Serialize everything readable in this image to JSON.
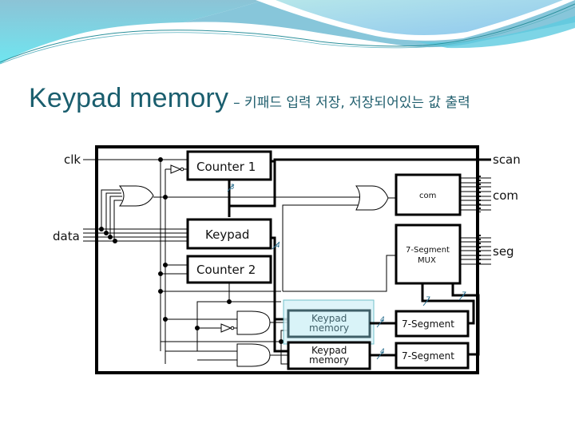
{
  "slide": {
    "title_main": "Keypad memory",
    "title_sub": "– 키패드 입력 저장, 저장되어있는 값 출력",
    "theme_colors": {
      "wave_light": "#a9dde6",
      "wave_mid": "#7fc4d6",
      "wave_cyan": "#6fe0ee",
      "wave_line": "#2a8f9a",
      "title": "#1a5e6e",
      "highlight_fill": "#d9f3f8",
      "highlight_border": "#5bb7c2"
    }
  },
  "diagram": {
    "ports": {
      "clk": "clk",
      "data": "data",
      "scan": "scan",
      "com": "com",
      "seg": "seg"
    },
    "blocks": {
      "counter1": "Counter 1",
      "keypad": "Keypad",
      "counter2": "Counter 2",
      "com": "com",
      "mux_line1": "7-Segment",
      "mux_line2": "MUX",
      "mem1_line1": "Keypad",
      "mem1_line2": "memory",
      "mem2_line1": "Keypad",
      "mem2_line2": "memory",
      "seg1": "7-Segment",
      "seg2": "7-Segment"
    },
    "bus_widths": {
      "counter1_out": "3",
      "keypad_out": "4",
      "mem1_out": "4",
      "mem2_out": "4",
      "seg1_out": "7",
      "seg2_out": "7"
    },
    "highlighted_block": "mem1"
  }
}
